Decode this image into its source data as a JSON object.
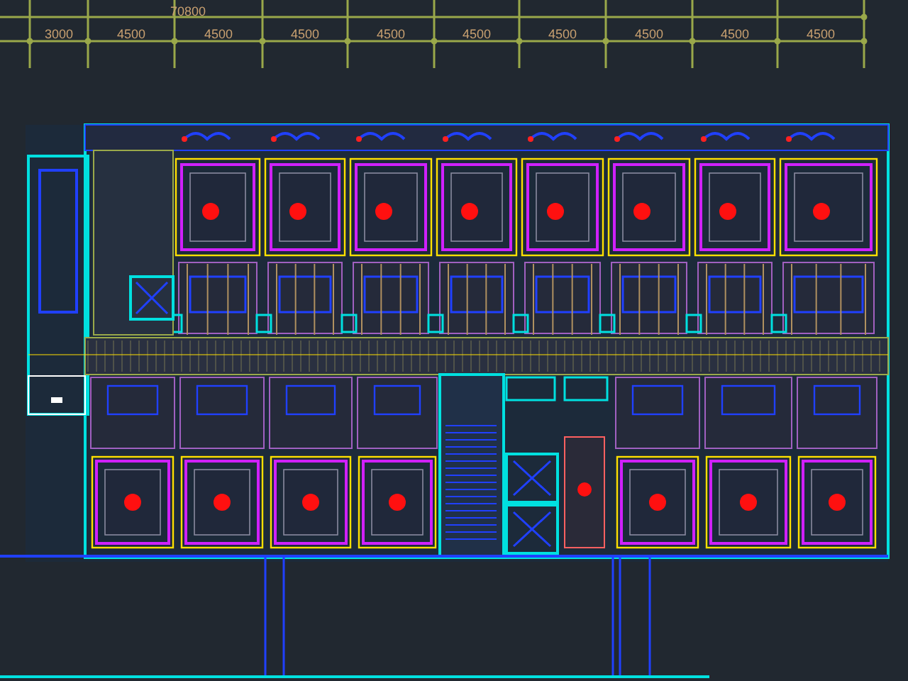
{
  "dimensions": {
    "total": "70800",
    "spans": [
      "3000",
      "4500",
      "4500",
      "4500",
      "4500",
      "4500",
      "4500",
      "4500",
      "4500",
      "4500"
    ]
  }
}
